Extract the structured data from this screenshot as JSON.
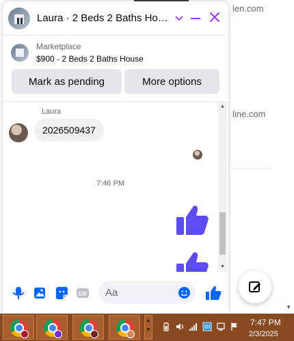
{
  "background": {
    "text_top": "len.com",
    "text_mid": "line.com"
  },
  "chat": {
    "title": "Laura · 2 Beds 2 Baths House",
    "marketplace_label": "Marketplace",
    "listing": "$900 - 2 Beds 2 Baths House",
    "mark_pending_label": "Mark as pending",
    "more_options_label": "More options",
    "sender_name": "Laura",
    "message_text": "2026509437",
    "timestamp": "7:46 PM",
    "input_placeholder": "Aa",
    "accent_color": "#a033ff",
    "like_color": "#5b4cf5"
  },
  "taskbar": {
    "apps": [
      {
        "name": "Chrome",
        "profile_color": "#b01030"
      },
      {
        "name": "Chrome",
        "profile_color": "#7a2bd4"
      },
      {
        "name": "Chrome",
        "profile_color": "#6b1d2a"
      },
      {
        "name": "Chrome",
        "profile_color": "#d28b5a"
      }
    ],
    "time": "7:47 PM",
    "date": "2/3/2025"
  }
}
